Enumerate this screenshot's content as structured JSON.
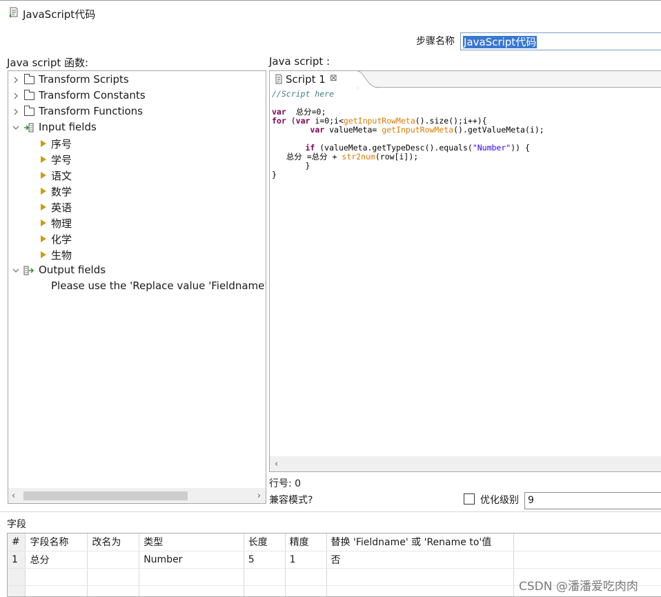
{
  "window": {
    "title": "JavaScript代码"
  },
  "step": {
    "label": "步骤名称",
    "value": "JavaScript代码"
  },
  "left_panel": {
    "label": "Java script 函数:"
  },
  "right_panel": {
    "label": "Java script :"
  },
  "tree": {
    "transform_scripts": "Transform Scripts",
    "transform_constants": "Transform Constants",
    "transform_functions": "Transform Functions",
    "input_fields": {
      "label": "Input fields",
      "children": [
        "序号",
        "学号",
        "语文",
        "数学",
        "英语",
        "物理",
        "化学",
        "生物"
      ]
    },
    "output_fields": {
      "label": "Output fields",
      "note": "Please use the 'Replace value 'Fieldname' c"
    }
  },
  "editor": {
    "tab_label": "Script 1",
    "code": {
      "l1": "//Script here",
      "kw_var": "var",
      "l3_rest": "  总分=0;",
      "kw_for": "for",
      "l4_a": " (",
      "l4_b": " i=0;i<",
      "fn_getInputRowMeta": "getInputRowMeta",
      "l4_c": "().size();i++){",
      "l5_rest": " valueMeta= ",
      "l5_c": "().getValueMeta(i);",
      "kw_if": "if",
      "l7_a": " (valueMeta.getTypeDesc().equals(",
      "str_number": "\"Number\"",
      "l7_b": ")) {",
      "l8_a": "   总分 =总分 + ",
      "fn_str2num": "str2num",
      "l8_b": "(row[i]);",
      "l9": "       }",
      "l10": "}"
    }
  },
  "status": {
    "line_number": "行号: 0",
    "compat_mode": "兼容模式?",
    "optimization_label": "优化级别",
    "optimization_value": "9"
  },
  "fields": {
    "label": "字段",
    "columns": [
      "#",
      "字段名称",
      "改名为",
      "类型",
      "长度",
      "精度",
      "替换 'Fieldname' 或 'Rename to'值"
    ],
    "rows": [
      [
        "1",
        "总分",
        "",
        "Number",
        "5",
        "1",
        "否"
      ]
    ]
  },
  "watermark": "CSDN @潘潘爱吃肉肉"
}
